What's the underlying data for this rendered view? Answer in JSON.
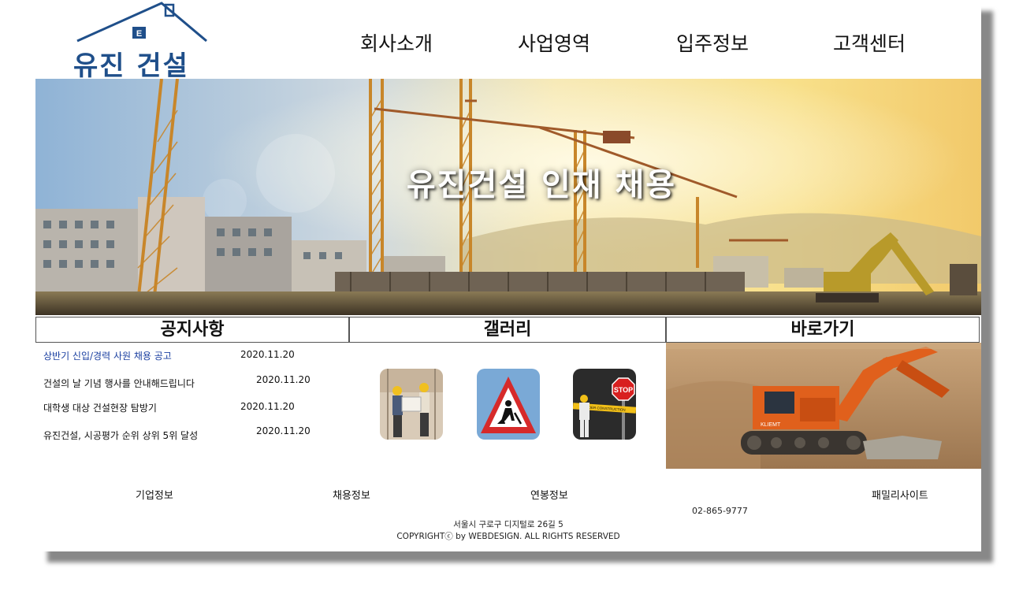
{
  "brand": {
    "logo_badge": "E",
    "logo_text": "유진 건설",
    "color": "#1f4f8a"
  },
  "nav": {
    "items": [
      "회사소개",
      "사업영역",
      "입주정보",
      "고객센터"
    ]
  },
  "hero": {
    "title": "유진건설 인재 채용"
  },
  "sections": {
    "notice": "공지사항",
    "gallery": "갤러리",
    "shortcut": "바로가기"
  },
  "notices": [
    {
      "title": "상반기 신입/경력 사원 채용 공고",
      "date": "2020.11.20"
    },
    {
      "title": "건설의 날 기념 행사를 안내해드립니다",
      "date": "2020.11.20"
    },
    {
      "title": "대학생 대상 건설현장 탐방기",
      "date": "2020.11.20"
    },
    {
      "title": "유진건설, 시공평가 순위 상위 5위 달성",
      "date": "2020.11.20"
    }
  ],
  "gallery": {
    "items": [
      "engineers-photo-icon",
      "road-work-sign-icon",
      "stop-sign-worker-icon"
    ],
    "sign_text": "STOP",
    "tape_text": "UNDER CONSTRUCTION"
  },
  "shortcut": {
    "machine_label": "KLIEMT"
  },
  "footer": {
    "links": [
      "기업정보",
      "채용정보",
      "연봉정보",
      "패밀리사이트"
    ],
    "phone": "02-865-9777",
    "address": "서울시 구로구 디지털로 26길 5",
    "copyright": "COPYRIGHTⓒ by WEBDESIGN. ALL RIGHTS RESERVED"
  }
}
